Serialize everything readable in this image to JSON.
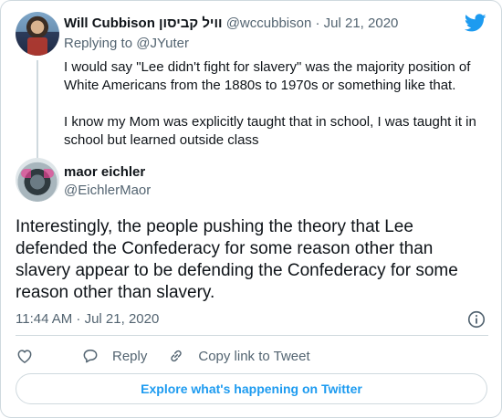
{
  "parent_tweet": {
    "display_name": "Will Cubbison וויל קביסון",
    "handle": "@wccubbison",
    "separator": "·",
    "date": "Jul 21, 2020",
    "replying_to_label": "Replying to",
    "replying_to_handle": "@JYuter",
    "paragraph1": "I would say \"Lee didn't fight for slavery\" was the majority position of White Americans from the 1880s to 1970s or something like that.",
    "paragraph2": "I know my Mom was explicitly taught that in school, I was taught it in school but learned outside class"
  },
  "main_tweet": {
    "display_name": "maor eichler",
    "handle": "@EichlerMaor",
    "text": "Interestingly, the people pushing the theory that Lee defended the Confederacy for some reason other than slavery appear to be defending the Confederacy for some reason other than slavery.",
    "timestamp": "11:44 AM · Jul 21, 2020"
  },
  "actions": {
    "reply_label": "Reply",
    "copy_link_label": "Copy link to Tweet"
  },
  "explore_button": "Explore what's happening on Twitter",
  "icons": {
    "brand": "twitter-bird-icon",
    "like": "heart-icon",
    "reply": "speech-bubble-icon",
    "copy": "link-icon",
    "info": "info-icon"
  },
  "colors": {
    "twitter_blue": "#1d9bf0",
    "muted_text": "#536471",
    "border": "#cfd9de"
  }
}
